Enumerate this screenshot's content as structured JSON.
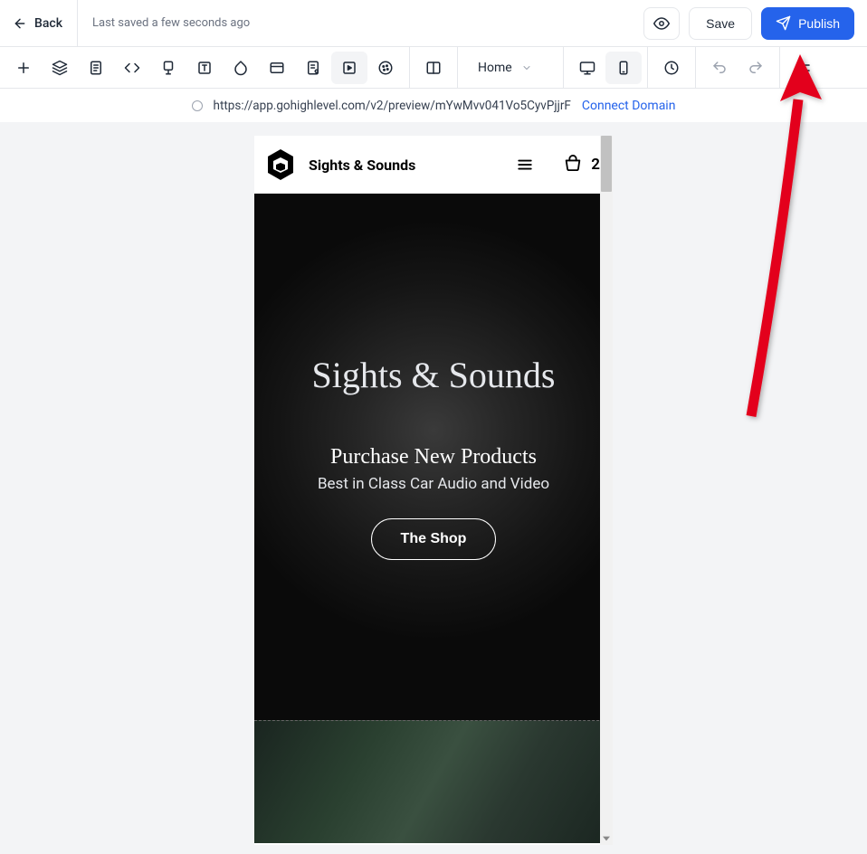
{
  "header": {
    "back_label": "Back",
    "saved_text": "Last saved a few seconds ago",
    "save_label": "Save",
    "publish_label": "Publish"
  },
  "toolbar": {
    "page_selected": "Home"
  },
  "url_bar": {
    "url": "https://app.gohighlevel.com/v2/preview/mYwMvv041Vo5CyvPjjrF",
    "connect_label": "Connect Domain"
  },
  "preview": {
    "site_name": "Sights & Sounds",
    "cart_count": "2",
    "hero": {
      "title": "Sights & Sounds",
      "subtitle": "Purchase New Products",
      "text": "Best in Class Car Audio and Video",
      "button_label": "The Shop"
    }
  }
}
